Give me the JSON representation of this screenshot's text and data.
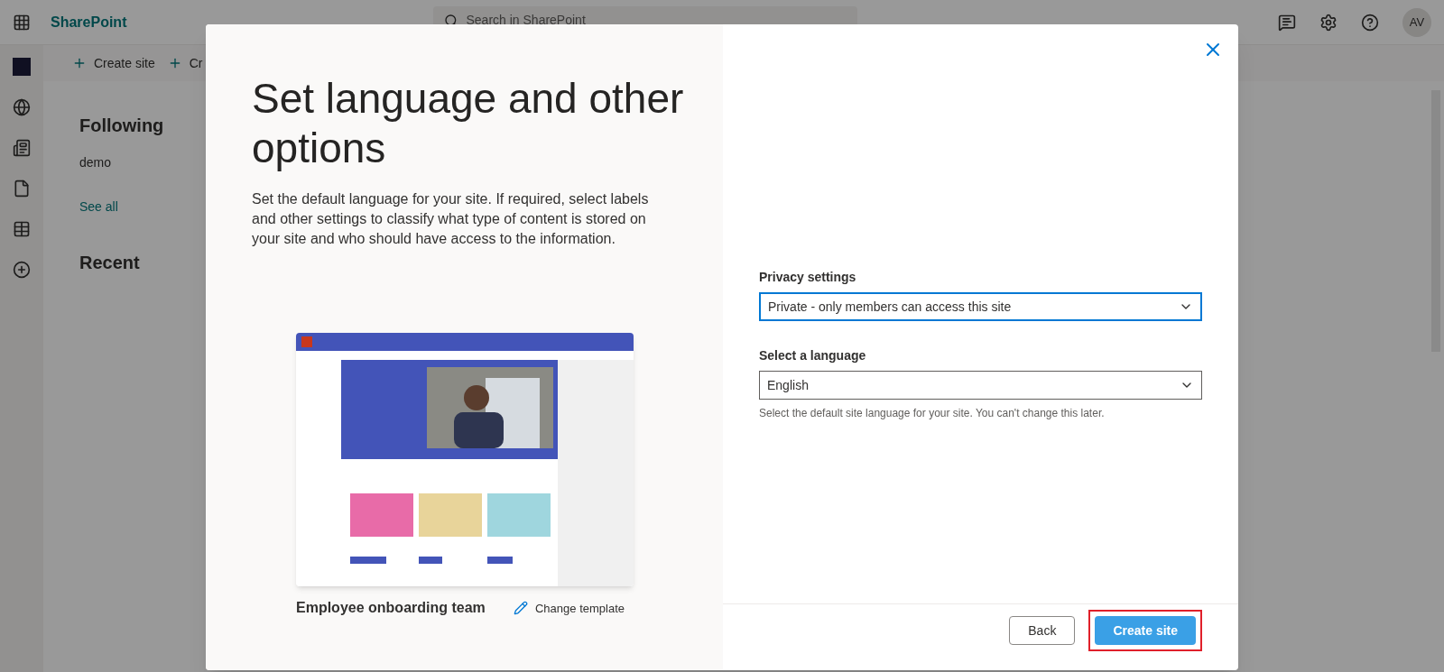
{
  "app": {
    "name": "SharePoint"
  },
  "search": {
    "placeholder": "Search in SharePoint"
  },
  "header": {
    "avatar": "AV"
  },
  "command_bar": [
    "Create site",
    "Cr"
  ],
  "following": {
    "title": "Following",
    "items": [
      "demo"
    ],
    "see_all": "See all"
  },
  "recent": {
    "title": "Recent"
  },
  "dialog": {
    "title": "Set language and other options",
    "description": "Set the default language for your site. If required, select labels and other settings to classify what type of content is stored on your site and who should have access to the information.",
    "template": {
      "name": "Employee onboarding team",
      "change": "Change template"
    },
    "fields": [
      {
        "label": "Privacy settings",
        "value": "Private - only members can access this site",
        "focused": true
      },
      {
        "label": "Select a language",
        "value": "English",
        "focused": false,
        "help": "Select the default site language for your site. You can't change this later."
      }
    ],
    "buttons": [
      {
        "label": "Back",
        "kind": "secondary",
        "highlighted": false
      },
      {
        "label": "Create site",
        "kind": "primary",
        "highlighted": true
      }
    ]
  }
}
